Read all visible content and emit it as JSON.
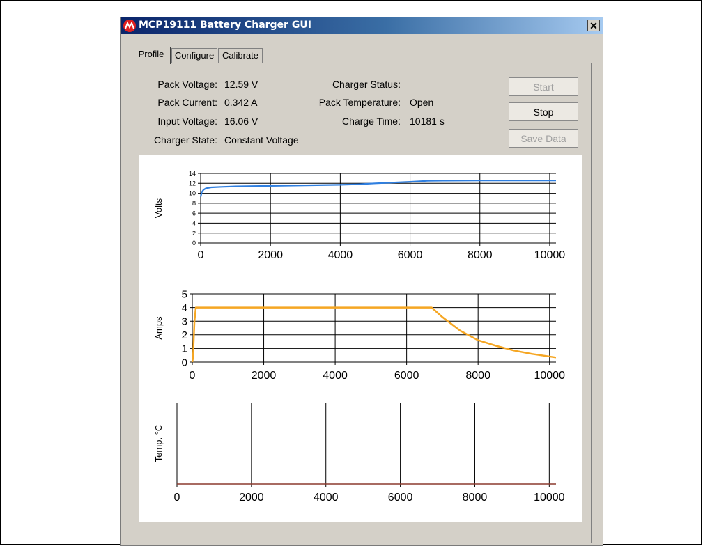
{
  "window": {
    "title": "MCP19111 Battery Charger GUI",
    "close_glyph": "✕"
  },
  "tabs": [
    {
      "label": "Profile",
      "active": true
    },
    {
      "label": "Configure",
      "active": false
    },
    {
      "label": "Calibrate",
      "active": false
    }
  ],
  "status": {
    "pack_voltage_label": "Pack Voltage:",
    "pack_voltage": "12.59 V",
    "pack_current_label": "Pack Current:",
    "pack_current": "0.342 A",
    "input_voltage_label": "Input Voltage:",
    "input_voltage": "16.06 V",
    "charger_state_label": "Charger State:",
    "charger_state": "Constant Voltage",
    "charger_status_label": "Charger Status:",
    "charger_status": "",
    "pack_temperature_label": "Pack Temperature:",
    "pack_temperature": "Open",
    "charge_time_label": "Charge Time:",
    "charge_time": "10181 s"
  },
  "buttons": {
    "start": "Start",
    "stop": "Stop",
    "save_data": "Save Data"
  },
  "colors": {
    "volts_line": "#2f7fe0",
    "amps_line": "#f5a623",
    "temp_line": "#8b3a2e"
  },
  "chart_data": [
    {
      "type": "line",
      "ylabel": "Volts",
      "xlim": [
        0,
        10181
      ],
      "ylim": [
        0,
        14
      ],
      "yticks": [
        0,
        2,
        4,
        6,
        8,
        10,
        12,
        14
      ],
      "xticks": [
        0,
        2000,
        4000,
        6000,
        8000,
        10000
      ],
      "grid": true,
      "series": [
        {
          "x": [
            0,
            30,
            80,
            150,
            300,
            600,
            1000,
            2000,
            3000,
            4000,
            4500,
            5000,
            6000,
            6500,
            7000,
            8000,
            9000,
            10181
          ],
          "y": [
            9.3,
            10.2,
            10.7,
            11.0,
            11.2,
            11.3,
            11.4,
            11.5,
            11.6,
            11.7,
            11.8,
            12.0,
            12.3,
            12.5,
            12.55,
            12.57,
            12.58,
            12.59
          ]
        }
      ]
    },
    {
      "type": "line",
      "ylabel": "Amps",
      "xlim": [
        0,
        10181
      ],
      "ylim": [
        0,
        5
      ],
      "yticks": [
        0,
        1,
        2,
        3,
        4,
        5
      ],
      "xticks": [
        0,
        2000,
        4000,
        6000,
        8000,
        10000
      ],
      "grid": true,
      "series": [
        {
          "x": [
            0,
            20,
            60,
            100,
            2000,
            4000,
            6000,
            6700,
            7000,
            7500,
            8000,
            8500,
            9000,
            9500,
            10181
          ],
          "y": [
            0,
            0.3,
            3.0,
            4.0,
            4.0,
            4.0,
            4.0,
            4.0,
            3.3,
            2.3,
            1.6,
            1.2,
            0.85,
            0.6,
            0.34
          ]
        }
      ]
    },
    {
      "type": "line",
      "ylabel": "Temp. °C",
      "xlim": [
        0,
        10181
      ],
      "xticks": [
        0,
        2000,
        4000,
        6000,
        8000,
        10000
      ],
      "grid": true,
      "series": [
        {
          "x": [
            0,
            10181
          ],
          "y": [
            0,
            0
          ]
        }
      ]
    }
  ]
}
